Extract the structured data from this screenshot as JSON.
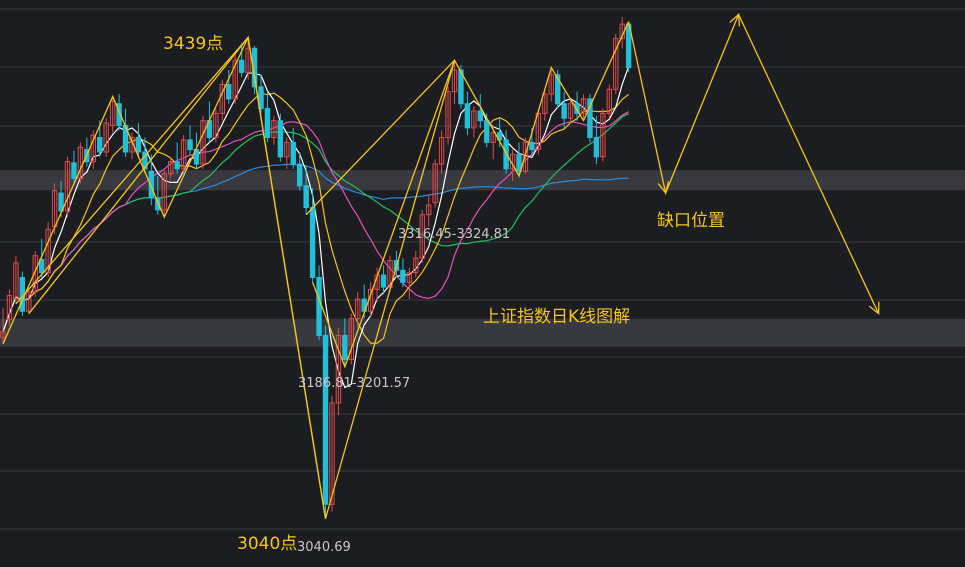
{
  "colors": {
    "background": "#1c1d21",
    "grid": "#3a3b40",
    "band": "#3c3d42",
    "up": "#e04b4b",
    "down": "#22c0d8",
    "ma5": "#ffffff",
    "ma10": "#f5c518",
    "ma20": "#e84fc0",
    "ma30": "#21c25e",
    "ma60": "#2b8de0",
    "wave": "#f5c518",
    "annotation": "#f5c518",
    "price_label": "#c8c8c8"
  },
  "chart_data": {
    "type": "candlestick",
    "title": "上证指数日K线图解",
    "ylim": [
      3000,
      3470
    ],
    "annotations": {
      "high": "3439点",
      "low": "3040点",
      "low_value": "3040.69",
      "gap_upper_range": "3316.45-3324.81",
      "gap_lower_range": "3186.81-3201.57",
      "gap_label": "缺口位置"
    },
    "gaps": [
      {
        "from": 3316.45,
        "to": 3324.81
      },
      {
        "from": 3186.81,
        "to": 3201.57
      }
    ],
    "candles": [
      [
        3190,
        3215,
        3185,
        3195
      ],
      [
        3205,
        3230,
        3200,
        3225
      ],
      [
        3222,
        3258,
        3218,
        3252
      ],
      [
        3240,
        3245,
        3208,
        3212
      ],
      [
        3212,
        3232,
        3210,
        3228
      ],
      [
        3228,
        3262,
        3224,
        3258
      ],
      [
        3255,
        3272,
        3240,
        3244
      ],
      [
        3244,
        3286,
        3240,
        3280
      ],
      [
        3282,
        3318,
        3276,
        3312
      ],
      [
        3310,
        3320,
        3290,
        3295
      ],
      [
        3295,
        3340,
        3290,
        3336
      ],
      [
        3335,
        3345,
        3318,
        3322
      ],
      [
        3322,
        3352,
        3318,
        3348
      ],
      [
        3346,
        3356,
        3332,
        3336
      ],
      [
        3336,
        3362,
        3330,
        3358
      ],
      [
        3356,
        3370,
        3340,
        3344
      ],
      [
        3344,
        3372,
        3340,
        3368
      ],
      [
        3366,
        3390,
        3360,
        3386
      ],
      [
        3384,
        3392,
        3362,
        3366
      ],
      [
        3366,
        3380,
        3340,
        3344
      ],
      [
        3344,
        3360,
        3338,
        3356
      ],
      [
        3356,
        3368,
        3340,
        3344
      ],
      [
        3344,
        3356,
        3326,
        3330
      ],
      [
        3328,
        3342,
        3300,
        3306
      ],
      [
        3306,
        3324,
        3292,
        3296
      ],
      [
        3296,
        3330,
        3290,
        3326
      ],
      [
        3326,
        3340,
        3322,
        3336
      ],
      [
        3336,
        3352,
        3326,
        3330
      ],
      [
        3330,
        3358,
        3326,
        3354
      ],
      [
        3354,
        3366,
        3342,
        3346
      ],
      [
        3346,
        3360,
        3330,
        3334
      ],
      [
        3334,
        3374,
        3330,
        3370
      ],
      [
        3370,
        3386,
        3352,
        3356
      ],
      [
        3356,
        3380,
        3352,
        3376
      ],
      [
        3376,
        3404,
        3370,
        3400
      ],
      [
        3400,
        3412,
        3384,
        3388
      ],
      [
        3388,
        3425,
        3384,
        3420
      ],
      [
        3420,
        3434,
        3406,
        3410
      ],
      [
        3410,
        3439,
        3404,
        3430
      ],
      [
        3430,
        3432,
        3392,
        3398
      ],
      [
        3398,
        3408,
        3376,
        3380
      ],
      [
        3380,
        3394,
        3352,
        3356
      ],
      [
        3356,
        3374,
        3350,
        3370
      ],
      [
        3370,
        3376,
        3336,
        3340
      ],
      [
        3340,
        3356,
        3330,
        3352
      ],
      [
        3352,
        3364,
        3330,
        3334
      ],
      [
        3334,
        3344,
        3312,
        3316
      ],
      [
        3316,
        3332,
        3292,
        3298
      ],
      [
        3298,
        3314,
        3236,
        3240
      ],
      [
        3240,
        3250,
        3188,
        3192
      ],
      [
        3192,
        3200,
        3040,
        3052
      ],
      [
        3052,
        3142,
        3046,
        3136
      ],
      [
        3136,
        3198,
        3126,
        3192
      ],
      [
        3192,
        3206,
        3166,
        3172
      ],
      [
        3172,
        3210,
        3168,
        3206
      ],
      [
        3206,
        3228,
        3198,
        3222
      ],
      [
        3222,
        3234,
        3206,
        3212
      ],
      [
        3212,
        3236,
        3208,
        3230
      ],
      [
        3230,
        3248,
        3220,
        3242
      ],
      [
        3242,
        3250,
        3226,
        3232
      ],
      [
        3232,
        3258,
        3228,
        3254
      ],
      [
        3254,
        3262,
        3240,
        3246
      ],
      [
        3246,
        3256,
        3232,
        3236
      ],
      [
        3236,
        3248,
        3222,
        3244
      ],
      [
        3244,
        3262,
        3240,
        3256
      ],
      [
        3256,
        3296,
        3252,
        3292
      ],
      [
        3292,
        3308,
        3282,
        3300
      ],
      [
        3302,
        3338,
        3298,
        3334
      ],
      [
        3334,
        3362,
        3326,
        3356
      ],
      [
        3356,
        3398,
        3350,
        3394
      ],
      [
        3394,
        3420,
        3384,
        3412
      ],
      [
        3412,
        3416,
        3380,
        3384
      ],
      [
        3384,
        3394,
        3358,
        3364
      ],
      [
        3364,
        3382,
        3356,
        3378
      ],
      [
        3378,
        3392,
        3364,
        3370
      ],
      [
        3370,
        3376,
        3348,
        3352
      ],
      [
        3352,
        3366,
        3338,
        3360
      ],
      [
        3360,
        3372,
        3348,
        3354
      ],
      [
        3354,
        3362,
        3326,
        3330
      ],
      [
        3330,
        3346,
        3320,
        3342
      ],
      [
        3342,
        3352,
        3324,
        3328
      ],
      [
        3328,
        3356,
        3326,
        3352
      ],
      [
        3352,
        3364,
        3340,
        3346
      ],
      [
        3346,
        3380,
        3342,
        3376
      ],
      [
        3376,
        3396,
        3370,
        3392
      ],
      [
        3392,
        3414,
        3386,
        3408
      ],
      [
        3408,
        3412,
        3380,
        3384
      ],
      [
        3384,
        3394,
        3364,
        3372
      ],
      [
        3372,
        3388,
        3368,
        3384
      ],
      [
        3384,
        3394,
        3370,
        3376
      ],
      [
        3376,
        3392,
        3370,
        3388
      ],
      [
        3388,
        3392,
        3352,
        3356
      ],
      [
        3356,
        3374,
        3334,
        3340
      ],
      [
        3340,
        3380,
        3336,
        3376
      ],
      [
        3376,
        3400,
        3372,
        3396
      ],
      [
        3396,
        3442,
        3392,
        3438
      ],
      [
        3438,
        3456,
        3430,
        3450
      ],
      [
        3450,
        3452,
        3410,
        3414
      ]
    ]
  }
}
